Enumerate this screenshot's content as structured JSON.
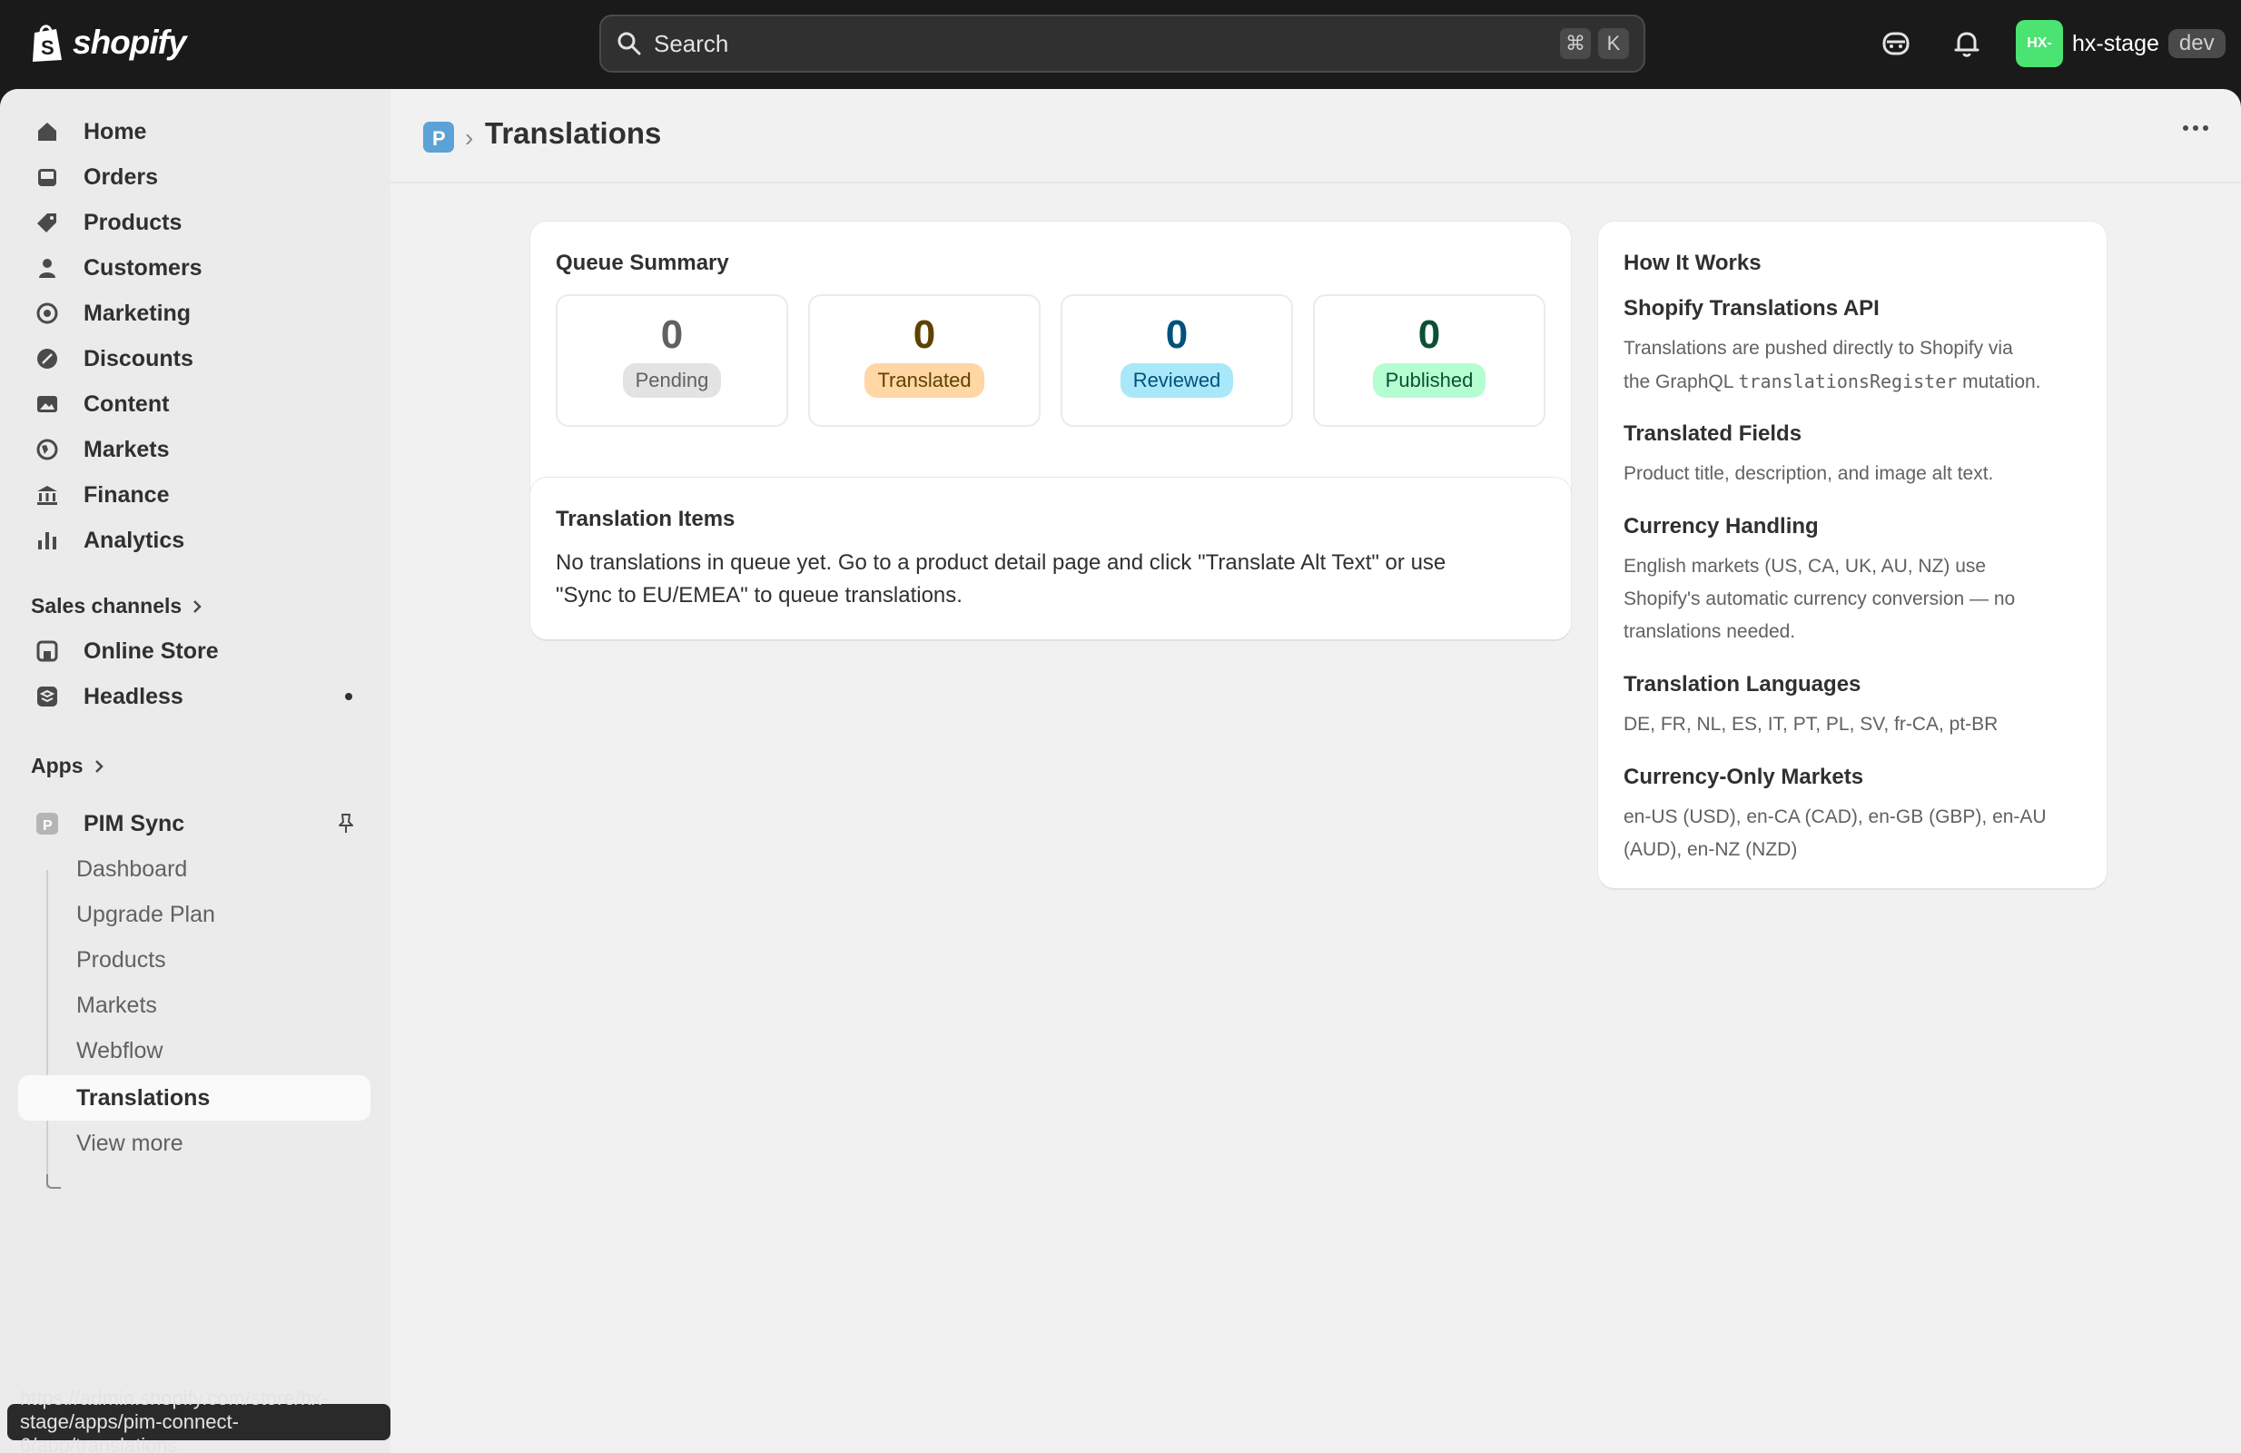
{
  "topbar": {
    "brand": "shopify",
    "search_placeholder": "Search",
    "shortcut_keys": [
      "⌘",
      "K"
    ],
    "store_initials": "HX-",
    "store_name": "hx-stage",
    "store_badge": "dev",
    "avatar_color": "#4be371"
  },
  "sidebar": {
    "main_nav": [
      {
        "label": "Home",
        "icon": "home-icon"
      },
      {
        "label": "Orders",
        "icon": "inbox-icon"
      },
      {
        "label": "Products",
        "icon": "tag-icon"
      },
      {
        "label": "Customers",
        "icon": "person-icon"
      },
      {
        "label": "Marketing",
        "icon": "target-icon"
      },
      {
        "label": "Discounts",
        "icon": "discount-icon"
      },
      {
        "label": "Content",
        "icon": "image-icon"
      },
      {
        "label": "Markets",
        "icon": "globe-icon"
      },
      {
        "label": "Finance",
        "icon": "bank-icon"
      },
      {
        "label": "Analytics",
        "icon": "bar-chart-icon"
      }
    ],
    "sales_channels_label": "Sales channels",
    "sales_channels": [
      {
        "label": "Online Store",
        "icon": "store-icon"
      },
      {
        "label": "Headless",
        "icon": "layers-icon"
      }
    ],
    "apps_label": "Apps",
    "app_name": "PIM Sync",
    "app_subnav": [
      "Dashboard",
      "Upgrade Plan",
      "Products",
      "Markets",
      "Webflow",
      "Translations",
      "View more"
    ],
    "active_subnav": "Translations"
  },
  "status_url": "https://admin.shopify.com/store/hx-stage/apps/pim-connect-6/app/translations",
  "header": {
    "title": "Translations"
  },
  "queue_summary": {
    "title": "Queue Summary",
    "stats": [
      {
        "value": "0",
        "label": "Pending",
        "num_color": "#616161",
        "badge_bg": "#e3e3e3",
        "badge_fg": "#616161"
      },
      {
        "value": "0",
        "label": "Translated",
        "num_color": "#5e4200",
        "badge_bg": "#ffd6a4",
        "badge_fg": "#5e4200"
      },
      {
        "value": "0",
        "label": "Reviewed",
        "num_color": "#00527c",
        "badge_bg": "#a8e8f8",
        "badge_fg": "#00527c"
      },
      {
        "value": "0",
        "label": "Published",
        "num_color": "#0c5132",
        "badge_bg": "#b4fed2",
        "badge_fg": "#0c5132"
      }
    ]
  },
  "translation_items": {
    "title": "Translation Items",
    "empty_line1": "No translations in queue yet. Go to a product detail page and click \"Translate Alt Text\" or use",
    "empty_line2": "\"Sync to EU/EMEA\" to queue translations."
  },
  "how_it_works": {
    "title": "How It Works",
    "sections": [
      {
        "heading": "Shopify Translations API",
        "line1": "Translations are pushed directly to Shopify via",
        "line2_pre": "the GraphQL ",
        "line2_code": "translationsRegister",
        "line2_post": " mutation."
      },
      {
        "heading": "Translated Fields",
        "line1": "Product title, description, and image alt text."
      },
      {
        "heading": "Currency Handling",
        "line1": "English markets (US, CA, UK, AU, NZ) use",
        "line2": "Shopify's automatic currency conversion — no",
        "line3": "translations needed."
      },
      {
        "heading": "Translation Languages",
        "line1": "DE, FR, NL, ES, IT, PT, PL, SV, fr-CA, pt-BR"
      },
      {
        "heading": "Currency-Only Markets",
        "line1": "en-US (USD), en-CA (CAD), en-GB (GBP), en-AU",
        "line2": "(AUD), en-NZ (NZD)"
      }
    ]
  }
}
